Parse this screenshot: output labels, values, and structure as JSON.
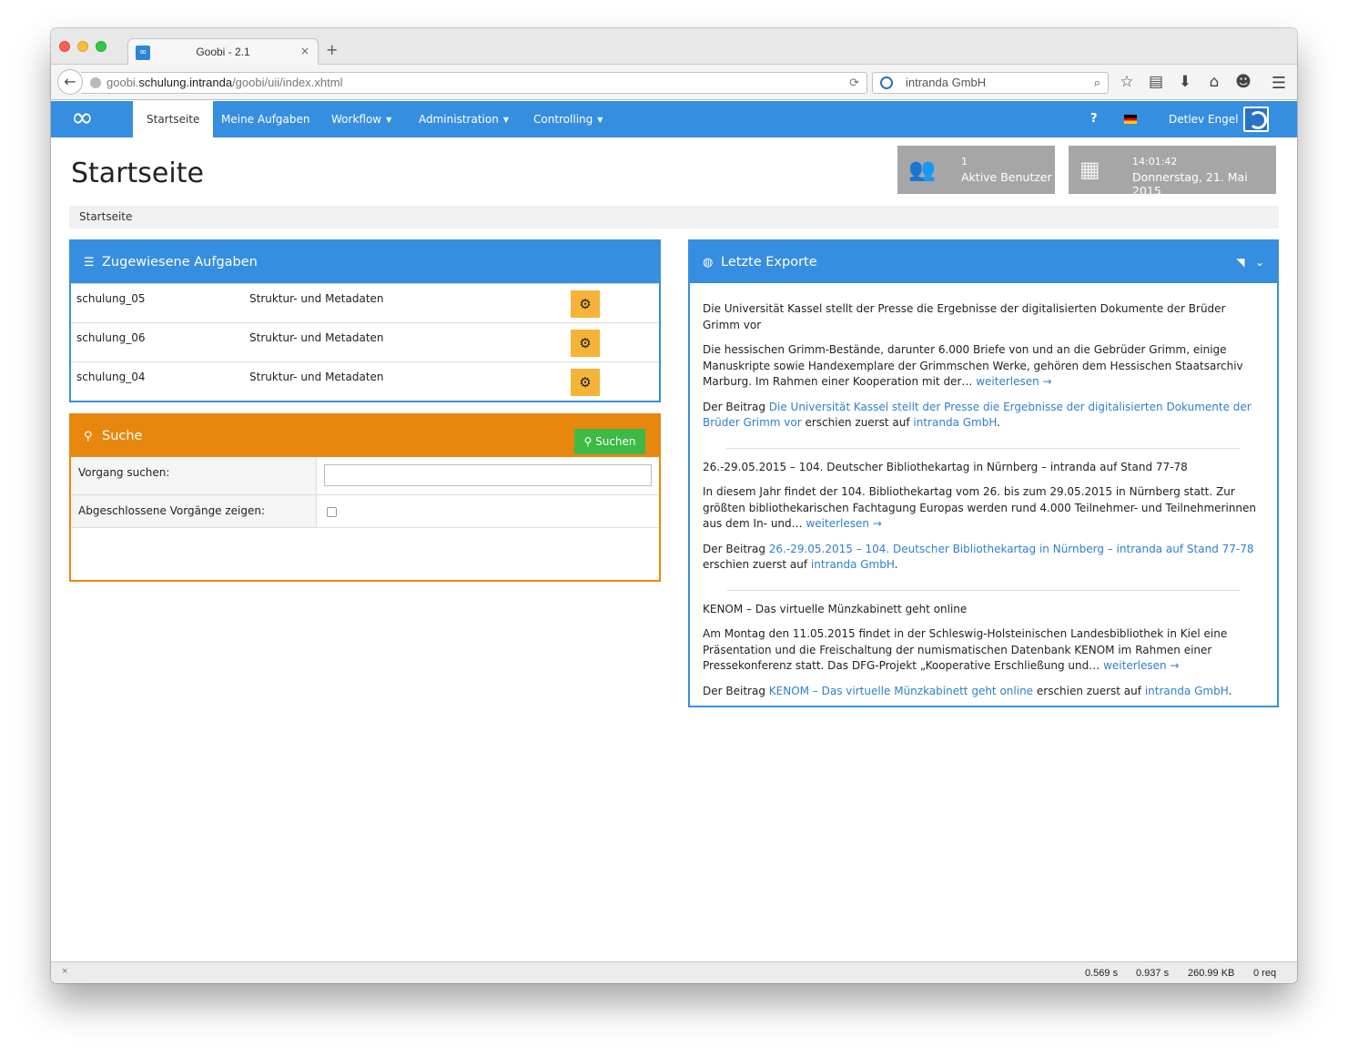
{
  "browser": {
    "tab_title": "Goobi - 2.1",
    "tab_close": "×",
    "new_tab": "+",
    "url_prefix": "goobi.",
    "url_domain": "schulung.intranda",
    "url_path": "/goobi/uii/index.xhtml",
    "search_text": "intranda GmbH",
    "back_glyph": "←",
    "reload_glyph": "⟳",
    "search_glyph": "⌕",
    "menu_glyph": "☰"
  },
  "nav": {
    "items": [
      {
        "label": "Startseite",
        "active": true
      },
      {
        "label": "Meine Aufgaben"
      },
      {
        "label": "Workflow",
        "caret": true
      },
      {
        "label": "Administration",
        "caret": true
      },
      {
        "label": "Controlling",
        "caret": true
      }
    ],
    "help": "?",
    "user": "Detlev Engel"
  },
  "header": {
    "title": "Startseite",
    "active_users_count": "1",
    "active_users_label": "Aktive Benutzer",
    "time": "14:01:42",
    "date": "Donnerstag, 21. Mai 2015"
  },
  "breadcrumb": "Startseite",
  "tasks": {
    "title": "Zugewiesene Aufgaben",
    "rows": [
      {
        "name": "schulung_05",
        "step": "Struktur- und Metadaten"
      },
      {
        "name": "schulung_06",
        "step": "Struktur- und Metadaten"
      },
      {
        "name": "schulung_04",
        "step": "Struktur- und Metadaten"
      }
    ]
  },
  "search": {
    "title": "Suche",
    "label_process": "Vorgang suchen:",
    "label_closed": "Abgeschlossene Vorgänge zeigen:",
    "button": "Suchen"
  },
  "exports": {
    "title": "Letzte Exporte",
    "articles": [
      {
        "headline": "Die Universität Kassel stellt der Presse die Ergebnisse der digitalisierten Dokumente der Brüder Grimm vor",
        "body": "Die hessischen Grimm-Bestände, darunter 6.000 Briefe von und an die Gebrüder Grimm, einige Manuskripte sowie Handexemplare der Grimmschen Werke, gehören dem Hessischen Staatsarchiv Marburg. Im Rahmen einer Kooperation mit der…",
        "more": "weiterlesen →",
        "footer_pre": "Der Beitrag",
        "footer_link": "Die Universität Kassel stellt der Presse die Ergebnisse der digitalisierten Dokumente der Brüder Grimm vor",
        "footer_mid": "erschien zuerst auf",
        "footer_site": "intranda GmbH",
        "footer_end": "."
      },
      {
        "headline": "26.-29.05.2015 – 104. Deutscher Bibliothekartag in Nürnberg – intranda auf Stand 77-78",
        "body": "In diesem Jahr findet der 104. Bibliothekartag vom 26. bis zum 29.05.2015 in Nürnberg statt.  Zur größten bibliothekarischen Fachtagung Europas werden rund 4.000 Teilnehmer- und Teilnehmerinnen aus dem In- und…",
        "more": "weiterlesen →",
        "footer_pre": "Der Beitrag",
        "footer_link": "26.-29.05.2015 – 104. Deutscher Bibliothekartag in Nürnberg – intranda auf Stand 77-78",
        "footer_mid": "erschien zuerst auf",
        "footer_site": "intranda GmbH",
        "footer_end": "."
      },
      {
        "headline": "KENOM – Das virtuelle Münzkabinett geht online",
        "body": "Am Montag den 11.05.2015 findet in der Schleswig-Holsteinischen Landesbibliothek in Kiel eine Präsentation und die Freischaltung der numismatischen Datenbank KENOM im Rahmen einer Pressekonferenz statt. Das DFG-Projekt „Kooperative Erschließung und…",
        "more": "weiterlesen →",
        "footer_pre": "Der Beitrag",
        "footer_link": "KENOM – Das virtuelle Münzkabinett geht online",
        "footer_mid": "erschien zuerst auf",
        "footer_site": "intranda GmbH",
        "footer_end": "."
      }
    ]
  },
  "statusbar": {
    "close": "×",
    "values": [
      "0.569 s",
      "0.937 s",
      "260.99 KB",
      "0 req"
    ]
  }
}
